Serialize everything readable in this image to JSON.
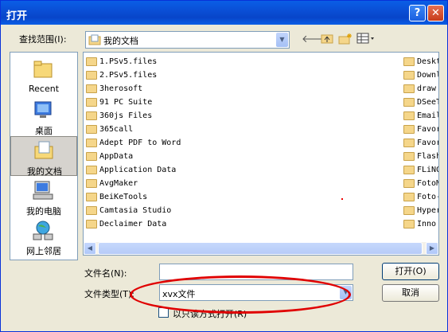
{
  "title": "打开",
  "title_buttons": {
    "help": "?",
    "close": "✕"
  },
  "look_in": {
    "label": "查找范围(I):",
    "value": "我的文档"
  },
  "places": [
    {
      "label": "Recent",
      "icon": "recent-folder-icon"
    },
    {
      "label": "桌面",
      "icon": "desktop-icon"
    },
    {
      "label": "我的文档",
      "icon": "my-documents-icon"
    },
    {
      "label": "我的电脑",
      "icon": "my-computer-icon"
    },
    {
      "label": "网上邻居",
      "icon": "network-places-icon"
    }
  ],
  "files_col1": [
    "1.PSv5.files",
    "2.PSv5.files",
    "3herosoft",
    "91 PC Suite",
    "360js Files",
    "365call",
    "Adept PDF to Word",
    "AppData",
    "Application Data",
    "AvgMaker",
    "BeiKeTools",
    "Camtasia Studio",
    "Declaimer Data"
  ],
  "files_col2": [
    "Deskt",
    "Downl",
    "draw",
    "DSeeT",
    "Email",
    "Favor",
    "Favor",
    "Flash",
    "FLiNG",
    "FotoM",
    "Foto-",
    "Hyper",
    "Inno"
  ],
  "filename": {
    "label": "文件名(N):",
    "value": ""
  },
  "filetype": {
    "label": "文件类型(T):",
    "value": "xvx文件"
  },
  "readonly": {
    "label": "以只读方式打开(R)"
  },
  "buttons": {
    "open": "打开(O)",
    "cancel": "取消"
  },
  "colors": {
    "titlebar": "#0a4fd6",
    "annotation": "#e00000",
    "folder": "#f5d68a"
  }
}
